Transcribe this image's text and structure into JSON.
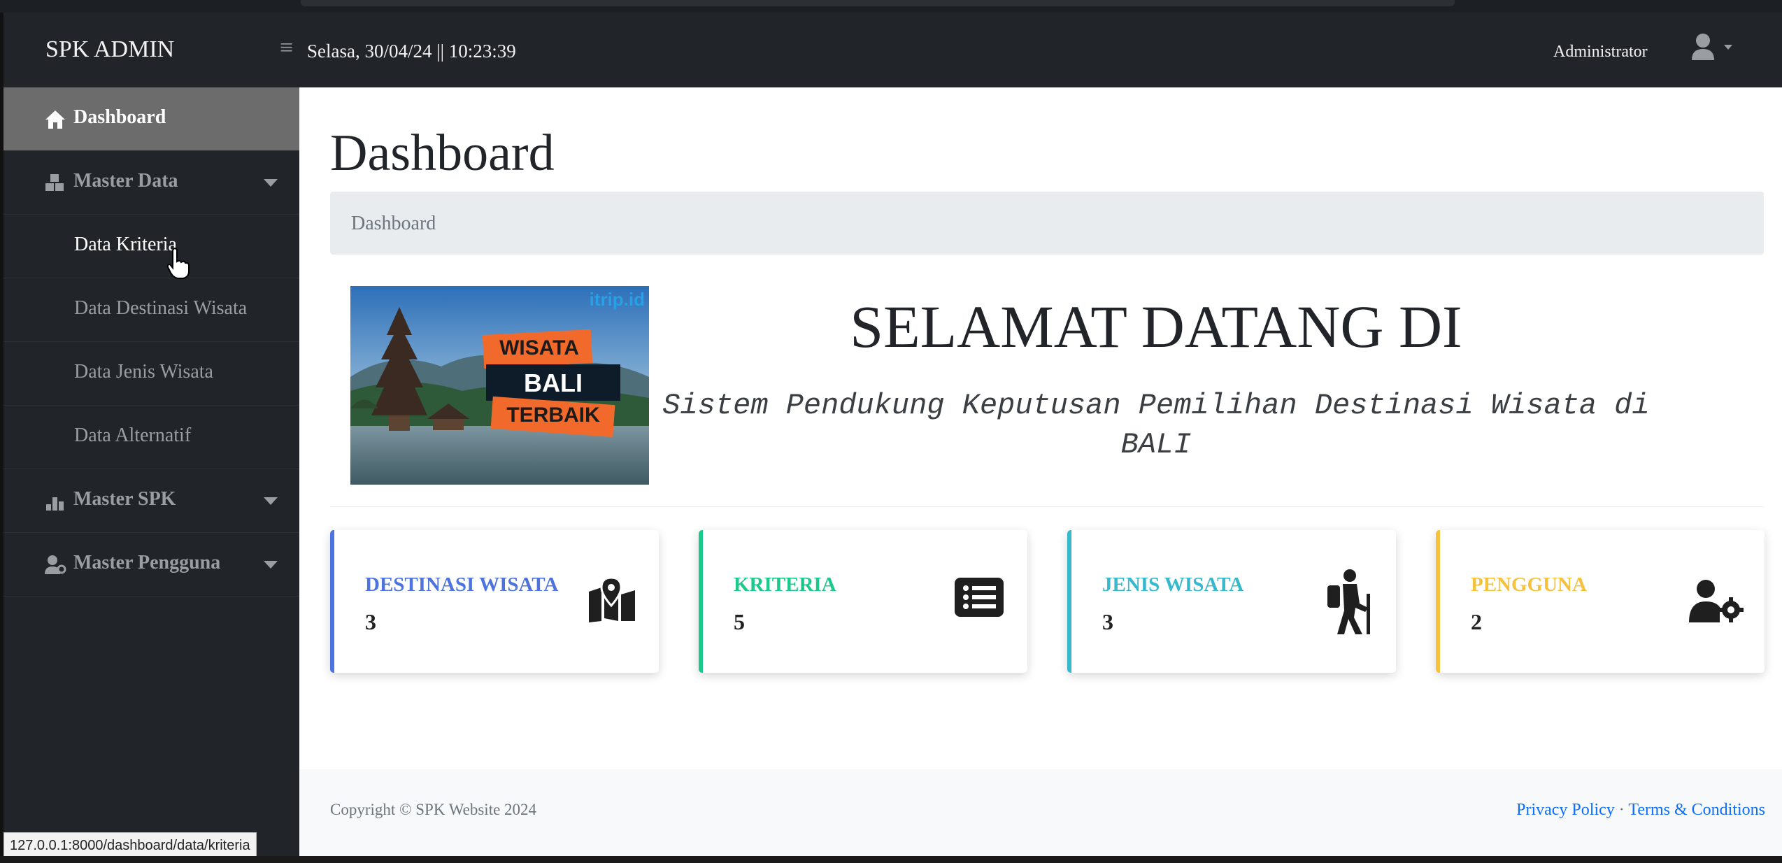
{
  "navbar": {
    "brand": "SPK ADMIN",
    "datetime": "Selasa, 30/04/24 || 10:23:39",
    "user": "Administrator"
  },
  "sidebar": {
    "items": [
      {
        "label": "Dashboard",
        "icon": "home-icon",
        "active": true
      },
      {
        "label": "Master Data",
        "icon": "cubes-icon",
        "expanded": true
      },
      {
        "label": "Data Kriteria",
        "sub": true
      },
      {
        "label": "Data Destinasi Wisata",
        "sub": true
      },
      {
        "label": "Data Jenis Wisata",
        "sub": true
      },
      {
        "label": "Data Alternatif",
        "sub": true
      },
      {
        "label": "Master SPK",
        "icon": "chart-icon"
      },
      {
        "label": "Master Pengguna",
        "icon": "users-icon"
      }
    ]
  },
  "main": {
    "title": "Dashboard",
    "breadcrumb": "Dashboard",
    "banner": {
      "brand": "itrip.id",
      "line1": "WISATA",
      "line2": "BALI",
      "line3": "TERBAIK"
    },
    "welcome": "SELAMAT DATANG DI",
    "tagline": "Sistem Pendukung Keputusan Pemilihan Destinasi Wisata di BALI",
    "cards": [
      {
        "title": "DESTINASI WISATA",
        "value": "3",
        "color": "#4e73df",
        "icon": "map-marker-icon"
      },
      {
        "title": "KRITERIA",
        "value": "5",
        "color": "#1cc88a",
        "icon": "list-icon"
      },
      {
        "title": "JENIS WISATA",
        "value": "3",
        "color": "#36b9cc",
        "icon": "hiking-icon"
      },
      {
        "title": "PENGGUNA",
        "value": "2",
        "color": "#f6c23e",
        "icon": "user-cog-icon"
      }
    ]
  },
  "footer": {
    "copyright": "Copyright © SPK Website 2024",
    "privacy": "Privacy Policy",
    "separator": "·",
    "terms": "Terms & Conditions"
  },
  "status_url": "127.0.0.1:8000/dashboard/data/kriteria"
}
